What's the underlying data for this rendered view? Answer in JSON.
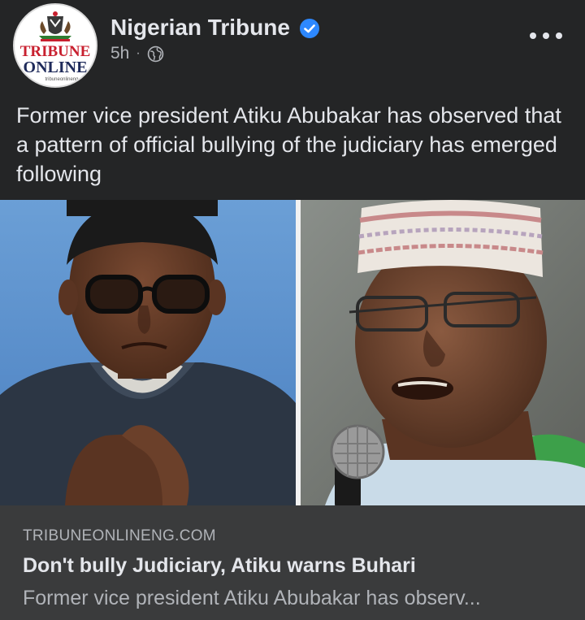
{
  "post": {
    "page_name": "Nigerian Tribune",
    "time": "5h",
    "separator": "·",
    "caption": "Former vice president Atiku Abubakar has observed that a pattern of official bullying of the judiciary has emerged following"
  },
  "logo": {
    "line1": "TRIBUNE",
    "line2": "ONLINE",
    "small": "tribuneonlineng"
  },
  "link_preview": {
    "domain": "TRIBUNEONLINENG.COM",
    "title": "Don't bully Judiciary, Atiku warns Buhari",
    "description": "Former vice president Atiku Abubakar has observ..."
  },
  "icons": {
    "verified": "verified-badge-icon",
    "audience": "globe-icon",
    "more": "more-options-icon"
  },
  "colors": {
    "background": "#242526",
    "link_box": "#3a3b3c",
    "verified": "#2d88ff",
    "primary_text": "#e4e6eb",
    "secondary_text": "#b0b3b8",
    "logo_red": "#c8202f",
    "logo_navy": "#1e2a5a"
  }
}
